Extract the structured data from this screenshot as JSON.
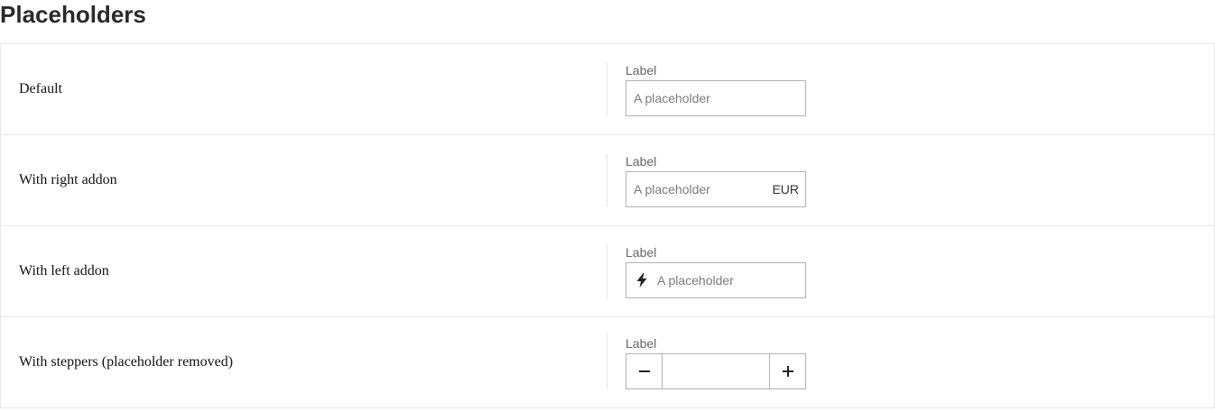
{
  "page": {
    "title": "Placeholders"
  },
  "rows": [
    {
      "label": "Default",
      "field": {
        "label": "Label",
        "value": "",
        "placeholder": "A placeholder"
      }
    },
    {
      "label": "With right addon",
      "field": {
        "label": "Label",
        "value": "",
        "placeholder": "A placeholder",
        "addon_right": "EUR"
      }
    },
    {
      "label": "With left addon",
      "field": {
        "label": "Label",
        "value": "",
        "placeholder": "A placeholder",
        "addon_left_icon": "lightning-bolt-icon"
      }
    },
    {
      "label": "With steppers (placeholder removed)",
      "field": {
        "label": "Label",
        "value": "",
        "decrement_icon": "minus-icon",
        "increment_icon": "plus-icon"
      }
    }
  ],
  "colors": {
    "border": "#b3b3b3",
    "row_border": "#e8e8e8",
    "label_text": "#666666",
    "placeholder_text": "#7a7a7a",
    "title_text": "#2a2a2a"
  }
}
